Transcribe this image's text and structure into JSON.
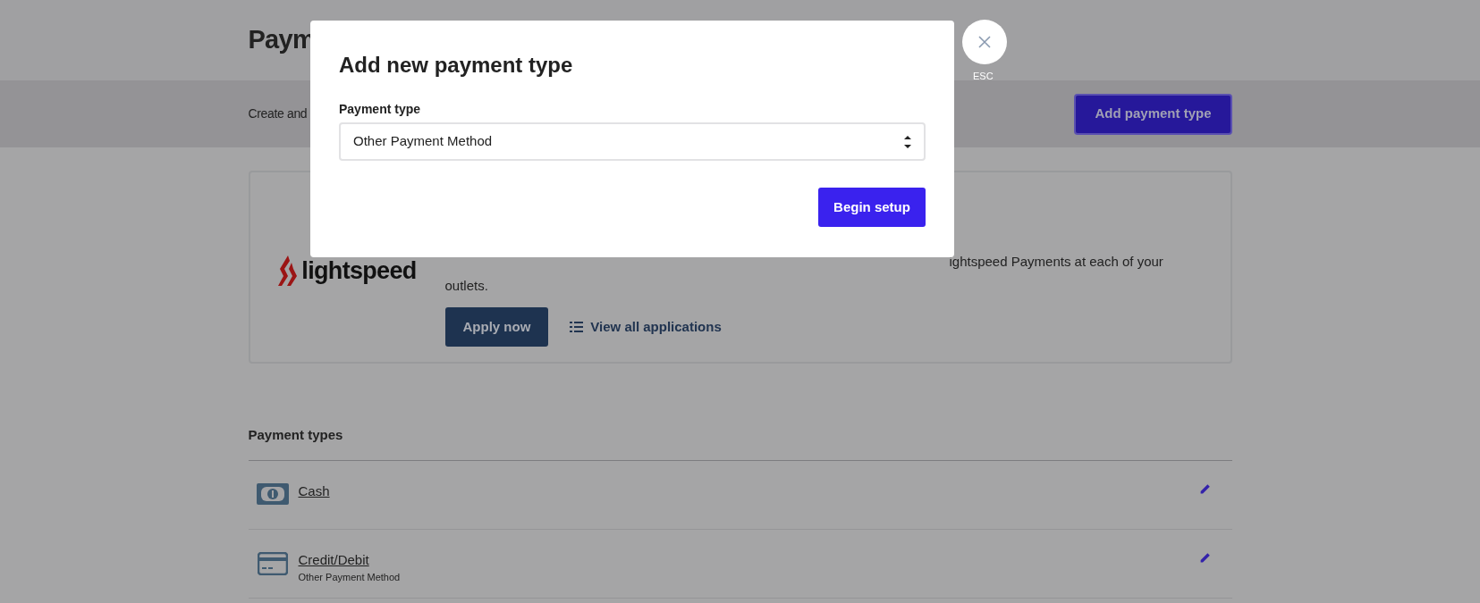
{
  "page": {
    "title": "Paym",
    "subtitle": "Create and",
    "add_button": "Add payment type"
  },
  "promo": {
    "logo_text": "lightspeed",
    "description": [
      "ightspeed Payments at each of your",
      "outlets."
    ],
    "apply_button": "Apply now",
    "view_link": "View all applications"
  },
  "payment_types": {
    "heading": "Payment types",
    "items": [
      {
        "kind": "cash",
        "name": "Cash"
      },
      {
        "kind": "card",
        "name": "Credit/Debit",
        "subtitle": "Other Payment Method"
      }
    ]
  },
  "modal": {
    "title": "Add new payment type",
    "field_label": "Payment type",
    "field_value": "Other Payment Method",
    "submit": "Begin setup",
    "close_hint": "ESC"
  }
}
